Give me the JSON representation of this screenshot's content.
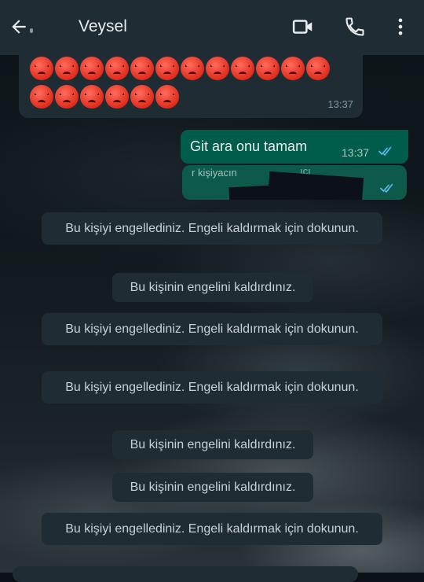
{
  "header": {
    "contact_name": "Veysel",
    "icons": [
      "back-arrow-icon",
      "video-call-icon",
      "phone-icon",
      "more-vert-icon"
    ]
  },
  "messages": {
    "incoming_time": "13:37",
    "outgoing_text": "Git ara onu tamam",
    "outgoing_time": "13:37",
    "partial_fragment_1": "r kişiyacın",
    "partial_fragment_2": "ıçı"
  },
  "system_notices": [
    {
      "text": "Bu kişiyi engellediniz. Engeli kaldırmak için dokunun."
    },
    {
      "text": "Bu kişinin engelini kaldırdınız."
    },
    {
      "text": "Bu kişiyi engellediniz. Engeli kaldırmak için dokunun."
    },
    {
      "text": "Bu kişiyi engellediniz. Engeli kaldırmak için dokunun."
    },
    {
      "text": "Bu kişinin engelini kaldırdınız."
    },
    {
      "text": "Bu kişinin engelini kaldırdınız."
    },
    {
      "text": "Bu kişiyi engellediniz. Engeli kaldırmak için dokunun."
    }
  ],
  "colors": {
    "header_bg": "#1f2c34",
    "outgoing_bubble": "#005c4b",
    "read_ticks": "#53bdeb"
  }
}
